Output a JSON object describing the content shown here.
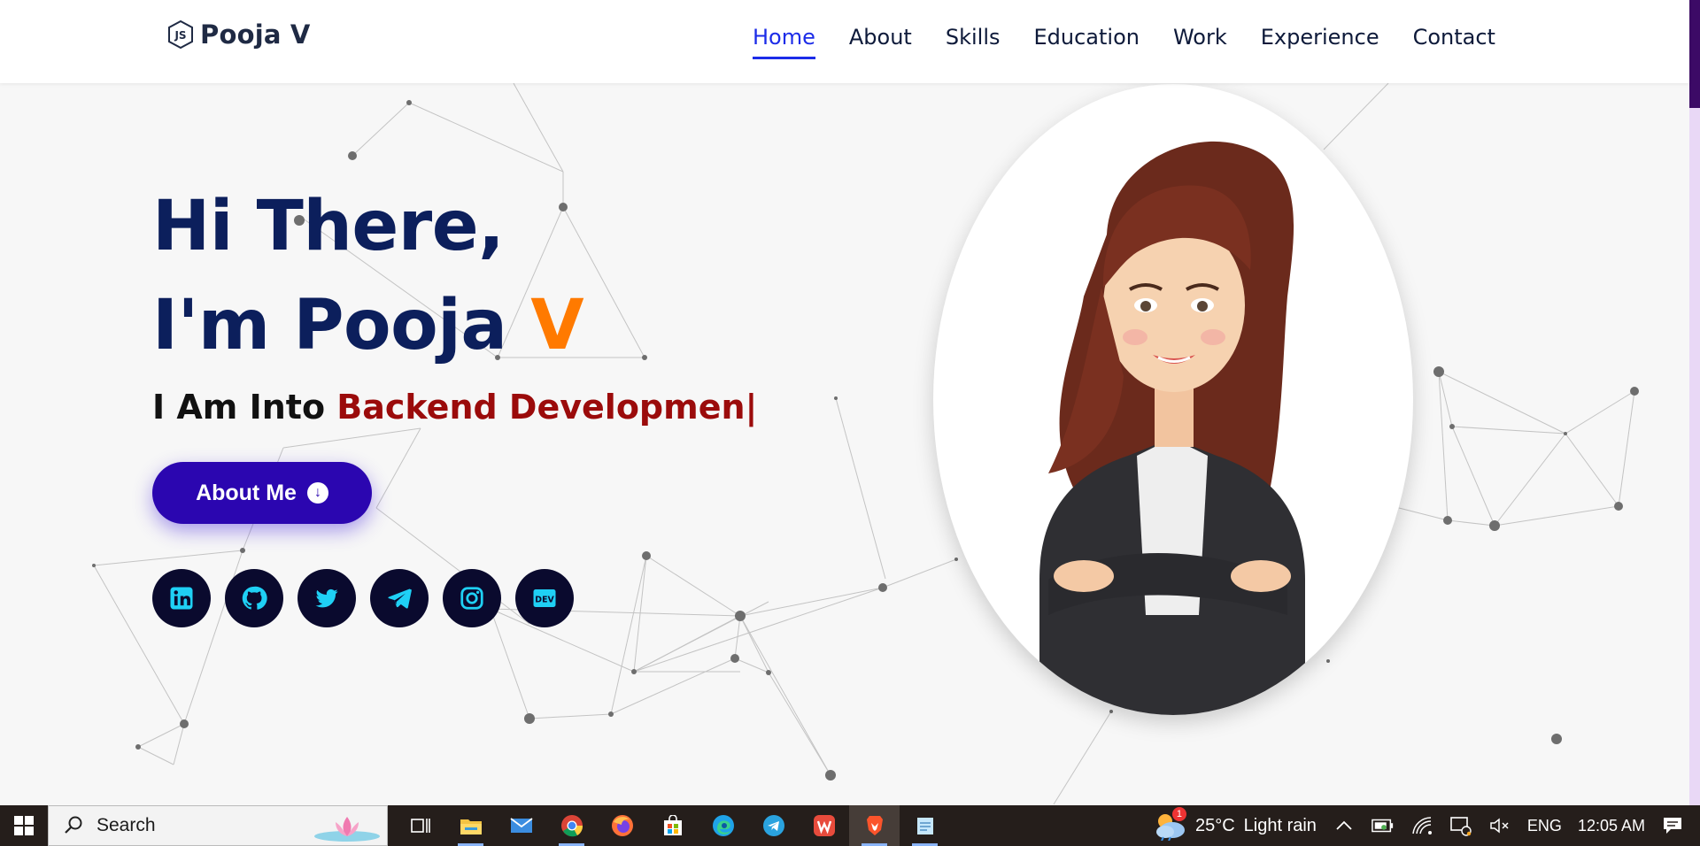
{
  "header": {
    "brand_name": "Pooja V",
    "brand_icon": "js-icon",
    "nav": [
      {
        "label": "Home",
        "active": true
      },
      {
        "label": "About",
        "active": false
      },
      {
        "label": "Skills",
        "active": false
      },
      {
        "label": "Education",
        "active": false
      },
      {
        "label": "Work",
        "active": false
      },
      {
        "label": "Experience",
        "active": false
      },
      {
        "label": "Contact",
        "active": false
      }
    ]
  },
  "hero": {
    "line1": "Hi There,",
    "line2_prefix": "I'm Pooja ",
    "line2_accent": "V",
    "tagline_prefix": "I Am Into ",
    "tagline_typed": "Backend Developmen|",
    "about_button": "About Me",
    "about_button_icon": "arrow-down-circle-icon",
    "portrait_icon": "businesswoman-avatar",
    "socials": [
      {
        "name": "linkedin-icon",
        "text": "in"
      },
      {
        "name": "github-icon",
        "text": ""
      },
      {
        "name": "twitter-icon",
        "text": ""
      },
      {
        "name": "telegram-icon",
        "text": ""
      },
      {
        "name": "instagram-icon",
        "text": ""
      },
      {
        "name": "dev-icon",
        "text": "DEV"
      }
    ]
  },
  "taskbar": {
    "search_placeholder": "Search",
    "weather_badge": "1",
    "weather_temp": "25°C",
    "weather_desc": "Light rain",
    "language": "ENG",
    "time": "12:05 AM",
    "apps": [
      "task-view-icon",
      "file-explorer-icon",
      "mail-icon",
      "chrome-icon",
      "firefox-icon",
      "store-icon",
      "edge-icon",
      "telegram-icon",
      "wps-icon",
      "brave-icon",
      "notepad-icon"
    ]
  },
  "colors": {
    "brand_dark": "#0c1f5c",
    "accent_orange": "#ff7a00",
    "typed_red": "#9b0b0b",
    "button_purple": "#2b06b0",
    "nav_active": "#1c2ce8",
    "social_bg": "#0a0a2e",
    "social_icon": "#1fd0f5"
  }
}
